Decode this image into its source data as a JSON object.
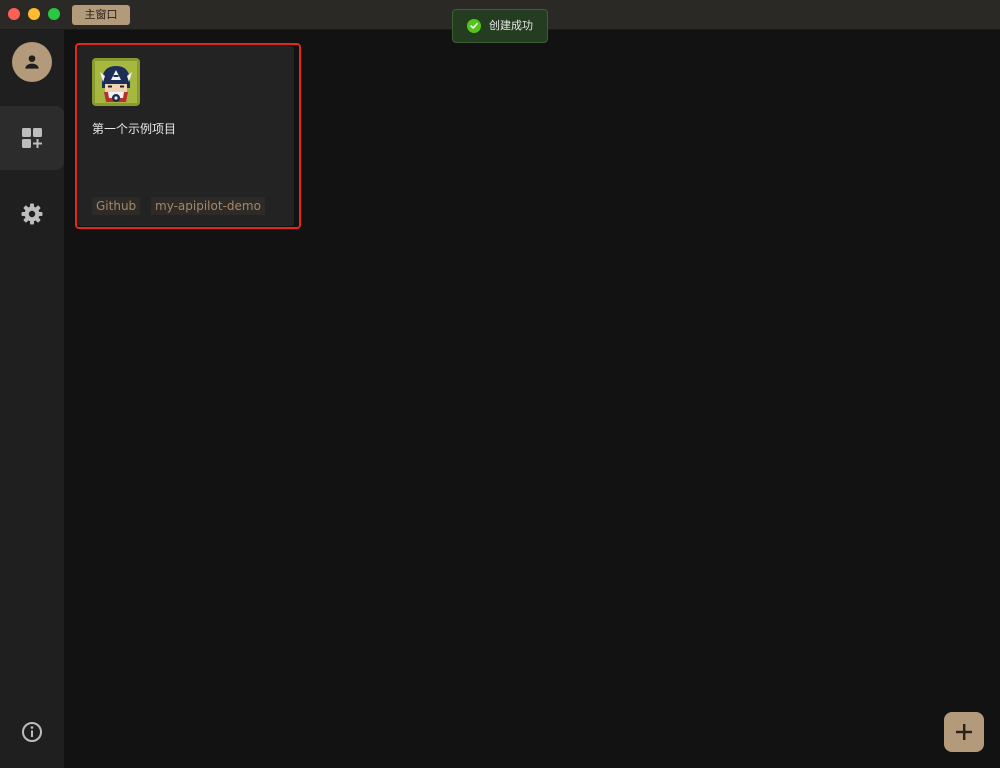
{
  "window": {
    "tab_label": "主窗口"
  },
  "toast": {
    "message": "创建成功",
    "icon": "check-circle-icon",
    "color": "#53c41a"
  },
  "sidebar": {
    "items": [
      {
        "icon": "user-icon"
      },
      {
        "icon": "dashboard-add-icon",
        "active": true
      },
      {
        "icon": "gear-icon"
      },
      {
        "icon": "info-icon"
      }
    ]
  },
  "projects": [
    {
      "title": "第一个示例项目",
      "icon": "captain-america-avatar-icon",
      "tags": [
        "Github",
        "my-apipilot-demo"
      ]
    }
  ],
  "colors": {
    "accent": "#b39a7a",
    "highlight": "#e5271c",
    "background": "#121212",
    "sidebar": "#1f1f1f"
  },
  "fab": {
    "icon": "plus-icon"
  }
}
